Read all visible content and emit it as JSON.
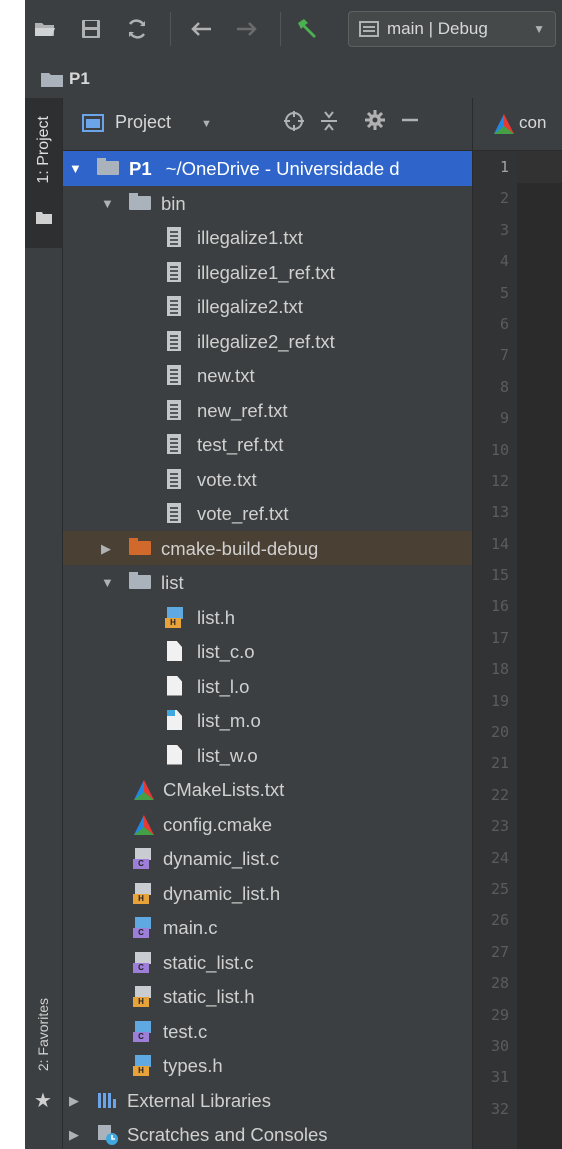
{
  "toolbar": {
    "buttons": [
      {
        "name": "open-icon",
        "glyph": "▬"
      },
      {
        "name": "save-icon",
        "glyph": "▣"
      },
      {
        "name": "sync-icon",
        "glyph": "⟳"
      },
      {
        "name": "back-icon",
        "glyph": "←"
      },
      {
        "name": "forward-icon",
        "glyph": "→"
      },
      {
        "name": "build-hammer-icon",
        "glyph": "⚒"
      }
    ],
    "run_config_label": "main | Debug",
    "accent_build": "#4caf50"
  },
  "breadcrumb": {
    "project_label": "P1"
  },
  "stripe": {
    "project_tab_label": "1: Project",
    "favorites_tab_label": "2: Favorites"
  },
  "panel": {
    "title": "Project"
  },
  "tree": {
    "root_name": "P1",
    "root_path": "~/OneDrive - Universidade d",
    "bin_folder": "bin",
    "bin_files": [
      "illegalize1.txt",
      "illegalize1_ref.txt",
      "illegalize2.txt",
      "illegalize2_ref.txt",
      "new.txt",
      "new_ref.txt",
      "test_ref.txt",
      "vote.txt",
      "vote_ref.txt"
    ],
    "cmake_folder": "cmake-build-debug",
    "list_folder": "list",
    "list_files": [
      "list.h",
      "list_c.o",
      "list_l.o",
      "list_m.o",
      "list_w.o"
    ],
    "root_files": [
      "CMakeLists.txt",
      "config.cmake",
      "dynamic_list.c",
      "dynamic_list.h",
      "main.c",
      "static_list.c",
      "static_list.h",
      "test.c",
      "types.h"
    ],
    "external_libraries": "External Libraries",
    "scratches": "Scratches and Consoles"
  },
  "editor": {
    "tab_label": "con",
    "line_numbers": [
      "1",
      "2",
      "3",
      "4",
      "5",
      "6",
      "7",
      "8",
      "9",
      "10",
      "12",
      "13",
      "14",
      "15",
      "16",
      "17",
      "18",
      "19",
      "20",
      "21",
      "22",
      "23",
      "24",
      "25",
      "26",
      "27",
      "28",
      "29",
      "30",
      "31",
      "32"
    ]
  },
  "colors": {
    "background": "#3c3f41",
    "selection": "#2f65ca",
    "excluded_folder": "#d2692c"
  }
}
